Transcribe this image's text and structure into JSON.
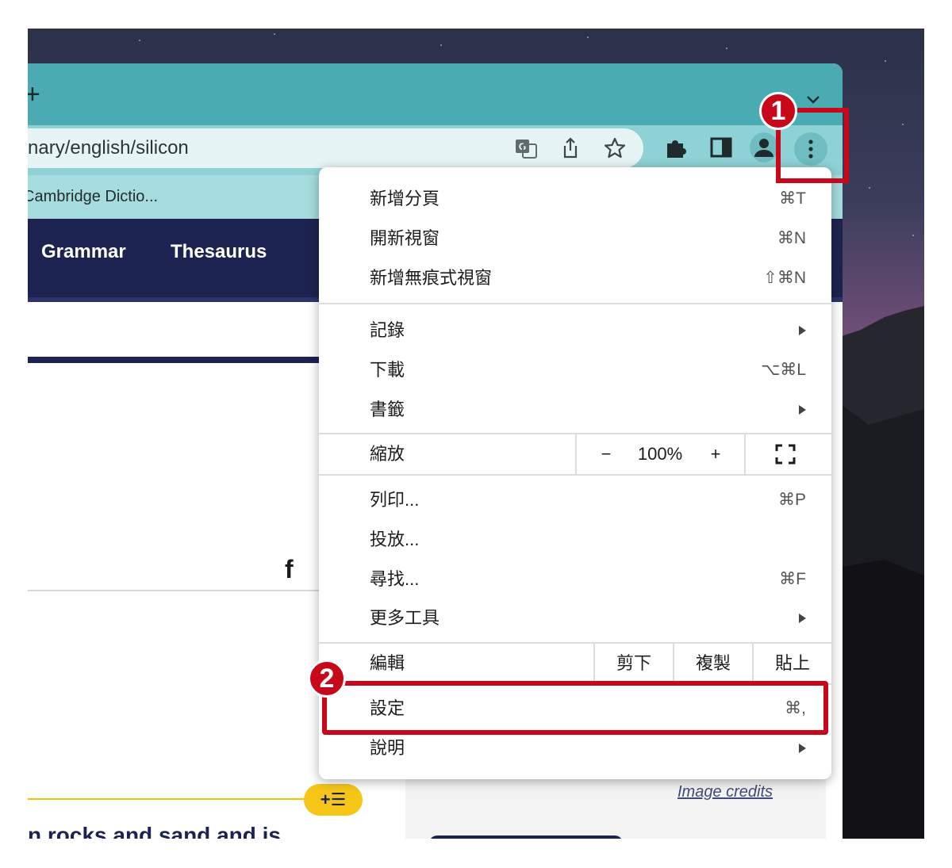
{
  "browser": {
    "new_tab_symbol": "+",
    "url": "nary/english/silicon",
    "bookmark": "Cambridge Dictio..."
  },
  "site_nav": {
    "links": [
      "Grammar",
      "Thesaurus"
    ]
  },
  "page": {
    "facebook_icon": "f",
    "wordlist_button": "+☰",
    "body_text": "n rocks and sand and is",
    "image_credits": "Image credits"
  },
  "menu": {
    "new_tab": {
      "label": "新增分頁",
      "shortcut": "⌘T"
    },
    "new_window": {
      "label": "開新視窗",
      "shortcut": "⌘N"
    },
    "new_incognito": {
      "label": "新增無痕式視窗",
      "shortcut": "⇧⌘N"
    },
    "history": {
      "label": "記錄"
    },
    "downloads": {
      "label": "下載",
      "shortcut": "⌥⌘L"
    },
    "bookmarks": {
      "label": "書籤"
    },
    "zoom": {
      "label": "縮放",
      "minus": "−",
      "value": "100%",
      "plus": "+"
    },
    "print": {
      "label": "列印...",
      "shortcut": "⌘P"
    },
    "cast": {
      "label": "投放..."
    },
    "find": {
      "label": "尋找...",
      "shortcut": "⌘F"
    },
    "more_tools": {
      "label": "更多工具"
    },
    "edit": {
      "label": "編輯",
      "cut": "剪下",
      "copy": "複製",
      "paste": "貼上"
    },
    "settings": {
      "label": "設定",
      "shortcut": "⌘,"
    },
    "help": {
      "label": "說明"
    }
  },
  "callouts": {
    "step1": "1",
    "step2": "2",
    "color": "#c8081a"
  },
  "colors": {
    "tabbar": "#4aabb3",
    "site_nav": "#1d2350",
    "accent_yellow": "#f5c518"
  }
}
